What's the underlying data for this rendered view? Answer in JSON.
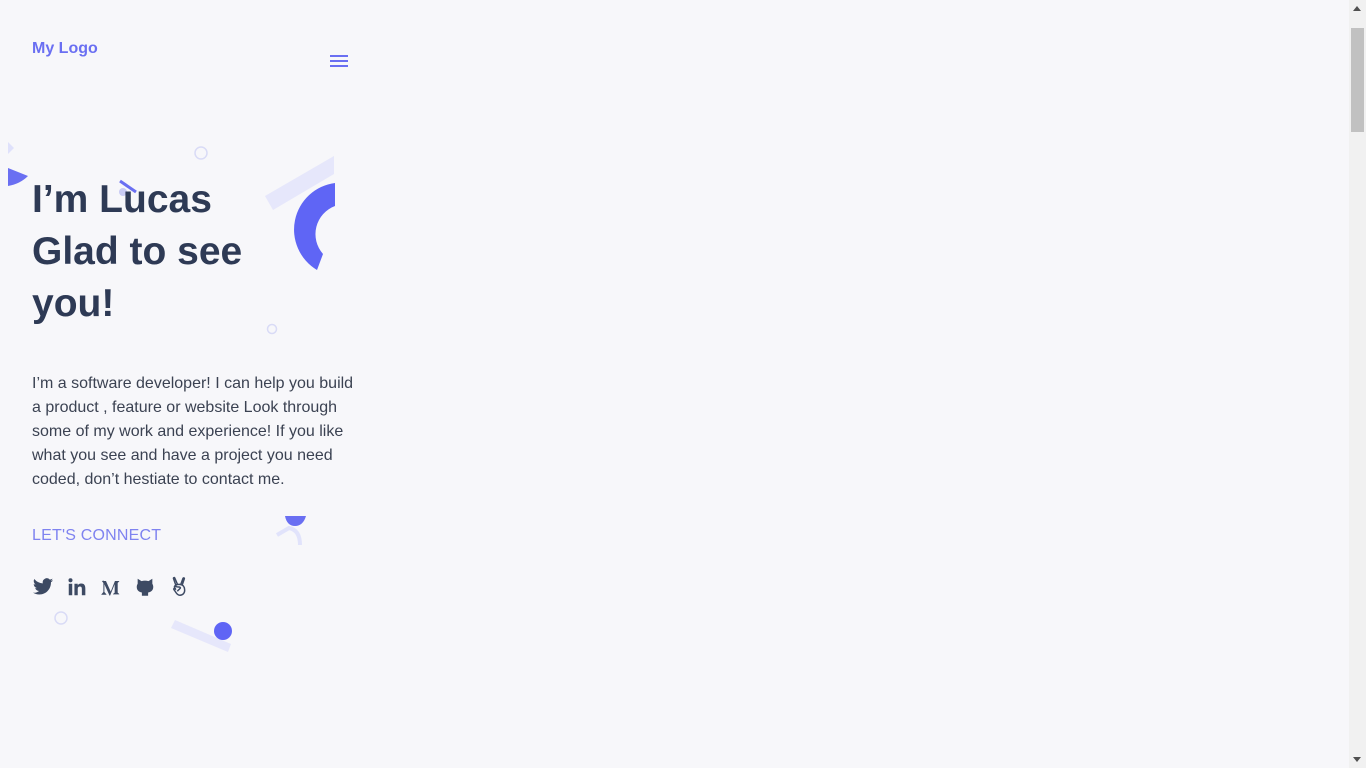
{
  "header": {
    "logo": "My Logo",
    "menu_icon": "hamburger-menu-icon"
  },
  "hero": {
    "title_line1": "I’m Lucas",
    "title_line2": "Glad to see",
    "title_line3": "you!",
    "intro": "I’m a software developer! I can help you build a product , feature or website Look through some of my work and experience! If you like what you see and have a project you need coded, don’t hestiate to contact me.",
    "connect": "LET'S CONNECT"
  },
  "socials": [
    {
      "icon": "twitter-icon"
    },
    {
      "icon": "linkedin-icon"
    },
    {
      "icon": "medium-icon"
    },
    {
      "icon": "github-icon"
    },
    {
      "icon": "angellist-icon"
    }
  ],
  "colors": {
    "background": "#f7f7fa",
    "accent": "#6a6ff2",
    "heading": "#2e3a55",
    "body_text": "#3b4252",
    "decor_light": "#e6e7fb"
  }
}
